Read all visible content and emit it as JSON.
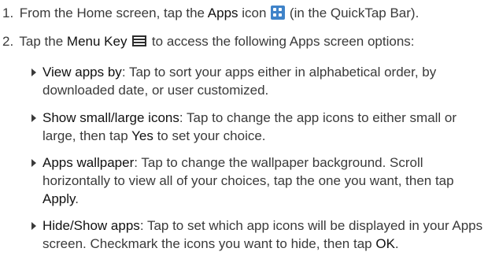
{
  "steps": [
    {
      "number": "1.",
      "before": "From the Home screen, tap the ",
      "term": "Apps",
      "middle": " icon ",
      "icon": "apps-grid-icon",
      "after": " (in the QuickTap Bar)."
    },
    {
      "number": "2.",
      "before": "Tap the ",
      "term": "Menu Key",
      "icon": "menu-key-icon",
      "after": " to access the following Apps screen options:"
    }
  ],
  "options": [
    {
      "term": "View apps by",
      "text": ": Tap to sort your apps either in alphabetical order, by downloaded date, or user customized."
    },
    {
      "term": "Show small/large icons",
      "text": ": Tap to change the app icons to either small or large, then tap ",
      "action": "Yes",
      "text_after": " to set your choice."
    },
    {
      "term": "Apps wallpaper",
      "text": ": Tap to change the wallpaper background. Scroll horizontally to view all of your choices, tap the one you want, then tap ",
      "action": "Apply",
      "text_after": "."
    },
    {
      "term": "Hide/Show apps",
      "text": ": Tap to set which app icons will be displayed in your Apps screen. Checkmark the icons you want to hide, then tap ",
      "action": "OK",
      "text_after": "."
    }
  ],
  "colors": {
    "text": "#3a3a3a",
    "apps_icon": "#3f83c9",
    "menu_icon": "#2e2e2e"
  }
}
